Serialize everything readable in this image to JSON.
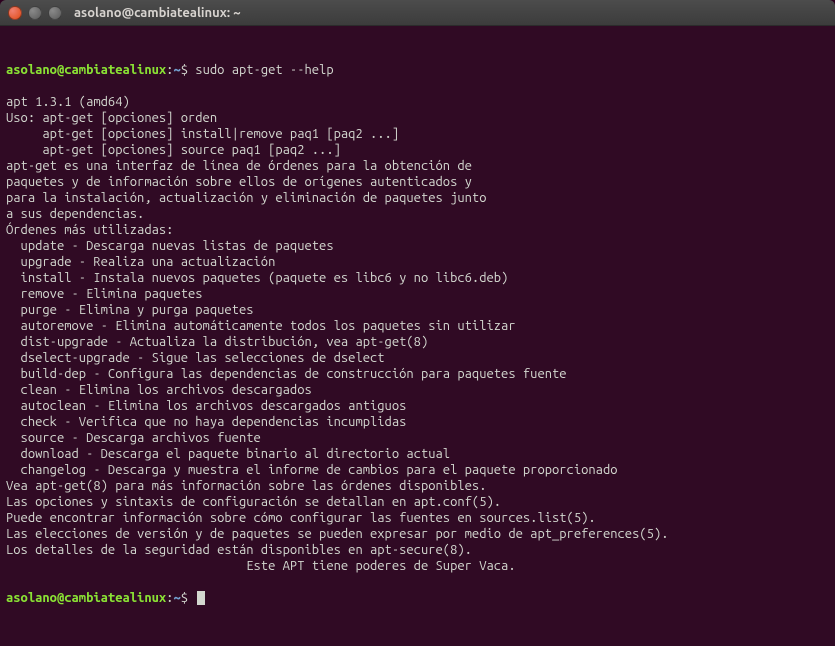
{
  "window": {
    "title": "asolano@cambiatealinux: ~"
  },
  "prompt": {
    "userhost": "asolano@cambiatealinux",
    "sep": ":",
    "path": "~",
    "sigil": "$"
  },
  "command1": "sudo apt-get --help",
  "output_lines": [
    "apt 1.3.1 (amd64)",
    "Uso: apt-get [opciones] orden",
    "     apt-get [opciones] install|remove paq1 [paq2 ...]",
    "     apt-get [opciones] source paq1 [paq2 ...]",
    "",
    "apt-get es una interfaz de línea de órdenes para la obtención de",
    "paquetes y de información sobre ellos de orígenes autenticados y",
    "para la instalación, actualización y eliminación de paquetes junto",
    "a sus dependencias.",
    "",
    "Órdenes más utilizadas:",
    "  update - Descarga nuevas listas de paquetes",
    "  upgrade - Realiza una actualización",
    "  install - Instala nuevos paquetes (paquete es libc6 y no libc6.deb)",
    "  remove - Elimina paquetes",
    "  purge - Elimina y purga paquetes",
    "  autoremove - Elimina automáticamente todos los paquetes sin utilizar",
    "  dist-upgrade - Actualiza la distribución, vea apt-get(8)",
    "  dselect-upgrade - Sigue las selecciones de dselect",
    "  build-dep - Configura las dependencias de construcción para paquetes fuente",
    "  clean - Elimina los archivos descargados",
    "  autoclean - Elimina los archivos descargados antiguos",
    "  check - Verifica que no haya dependencias incumplidas",
    "  source - Descarga archivos fuente",
    "  download - Descarga el paquete binario al directorio actual",
    "  changelog - Descarga y muestra el informe de cambios para el paquete proporcionado",
    "",
    "Vea apt-get(8) para más información sobre las órdenes disponibles.",
    "Las opciones y sintaxis de configuración se detallan en apt.conf(5).",
    "Puede encontrar información sobre cómo configurar las fuentes en sources.list(5).",
    "Las elecciones de versión y de paquetes se pueden expresar por medio de apt_preferences(5).",
    "Los detalles de la seguridad están disponibles en apt-secure(8).",
    "                                 Este APT tiene poderes de Super Vaca."
  ]
}
